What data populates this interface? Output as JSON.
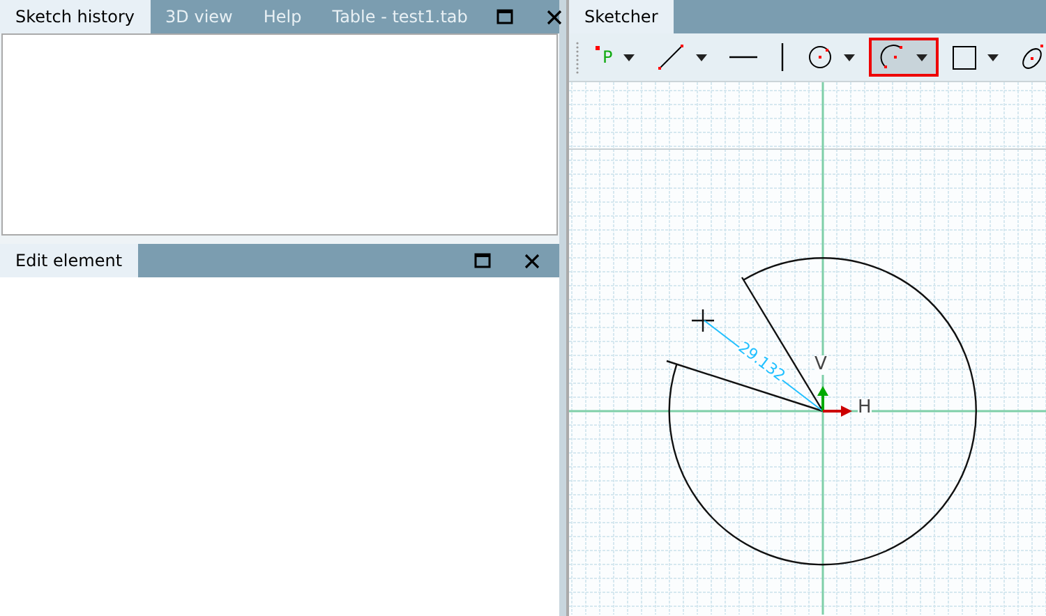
{
  "left_top_panel": {
    "tabs": [
      {
        "label": "Sketch history",
        "selected": true
      },
      {
        "label": "3D view",
        "selected": false
      },
      {
        "label": "Help",
        "selected": false
      },
      {
        "label": "Table - test1.tab",
        "selected": false
      }
    ]
  },
  "left_bottom_panel": {
    "tabs": [
      {
        "label": "Edit element",
        "selected": true
      }
    ]
  },
  "sketcher": {
    "tabs": [
      {
        "label": "Sketcher",
        "selected": true
      }
    ],
    "toolbar": [
      {
        "kind": "point",
        "label": "P",
        "dropdown": true,
        "selected": false
      },
      {
        "kind": "line",
        "dropdown": true,
        "selected": false
      },
      {
        "kind": "hline",
        "dropdown": false,
        "selected": false
      },
      {
        "kind": "vline",
        "dropdown": false,
        "selected": false
      },
      {
        "kind": "circle",
        "dropdown": true,
        "selected": false
      },
      {
        "kind": "arc",
        "dropdown": true,
        "selected": true
      },
      {
        "kind": "rectangle",
        "dropdown": true,
        "selected": false
      },
      {
        "kind": "ellipse",
        "dropdown": false,
        "selected": false
      }
    ],
    "canvas": {
      "dimension": "29.132",
      "axis_v": "V",
      "axis_h": "H"
    }
  }
}
